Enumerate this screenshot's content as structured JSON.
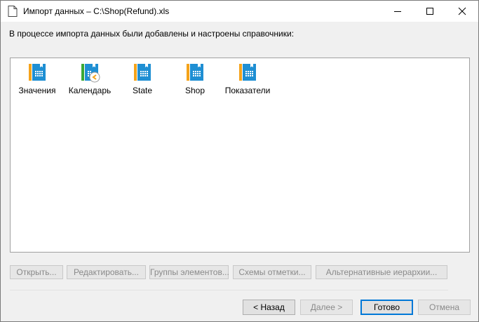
{
  "window": {
    "title": "Импорт данных – C:\\Shop(Refund).xls",
    "icon": "document-icon"
  },
  "intro_text": "В процессе импорта данных были добавлены и настроены справочники:",
  "dictionaries": [
    {
      "label": "Значения",
      "icon": "dictionary-icon",
      "accent": "#f5a31a"
    },
    {
      "label": "Календарь",
      "icon": "calendar-dictionary-icon",
      "accent": "#3aa935"
    },
    {
      "label": "State",
      "icon": "dictionary-icon",
      "accent": "#f5a31a"
    },
    {
      "label": "Shop",
      "icon": "dictionary-icon",
      "accent": "#f5a31a"
    },
    {
      "label": "Показатели",
      "icon": "dictionary-icon",
      "accent": "#f5a31a"
    }
  ],
  "actions": {
    "open": "Открыть...",
    "edit": "Редактировать...",
    "groups": "Группы элементов...",
    "schemes": "Схемы отметки...",
    "hierarchies": "Альтернативные иерархии..."
  },
  "nav": {
    "back": "< Назад",
    "next": "Далее >",
    "finish": "Готово",
    "cancel": "Отмена"
  },
  "colors": {
    "book_blue": "#1f8fd3",
    "default_button_border": "#0078d7"
  }
}
